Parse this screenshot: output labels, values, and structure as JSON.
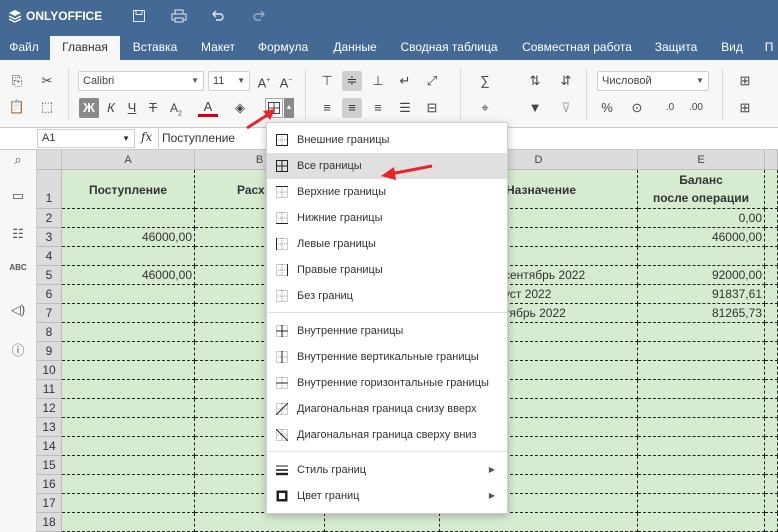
{
  "app": {
    "name": "ONLYOFFICE"
  },
  "menu": {
    "tabs": [
      "Файл",
      "Главная",
      "Вставка",
      "Макет",
      "Формула",
      "Данные",
      "Сводная таблица",
      "Совместная работа",
      "Защита",
      "Вид",
      "П"
    ],
    "active": "Главная"
  },
  "toolbar": {
    "font_name": "Calibri",
    "font_size": "11",
    "number_format": "Числовой"
  },
  "formula_bar": {
    "cell_ref": "A1",
    "fx": "fx",
    "content": "Поступление"
  },
  "columns": [
    "A",
    "B",
    "C",
    "D",
    "E"
  ],
  "rows": [
    "1",
    "2",
    "3",
    "4",
    "5",
    "6",
    "7",
    "8",
    "9",
    "10",
    "11",
    "12",
    "13",
    "14",
    "15",
    "16",
    "17",
    "18"
  ],
  "cells": {
    "A1": "Поступление",
    "B1": "Расх",
    "D1": "Назначение",
    "E1_line1": "Баланс",
    "E1_line2": "после операции",
    "E2": "0,00",
    "A3": "46000,00",
    "E3": "46000,00",
    "A5": "46000,00",
    "D5": "сентябрь 2022",
    "E5": "92000,00",
    "D6": "уст 2022",
    "E6": "91837,61",
    "D7": "тябрь 2022",
    "E7": "81265,73"
  },
  "border_menu": {
    "items": [
      {
        "label": "Внешние границы",
        "icon": "outer-borders-icon"
      },
      {
        "label": "Все границы",
        "icon": "all-borders-icon",
        "highlighted": true
      },
      {
        "label": "Верхние границы",
        "icon": "top-border-icon"
      },
      {
        "label": "Нижние границы",
        "icon": "bottom-border-icon"
      },
      {
        "label": "Левые границы",
        "icon": "left-border-icon"
      },
      {
        "label": "Правые границы",
        "icon": "right-border-icon"
      },
      {
        "label": "Без границ",
        "icon": "no-borders-icon"
      },
      {
        "label": "Внутренние границы",
        "icon": "inner-borders-icon"
      },
      {
        "label": "Внутренние вертикальные границы",
        "icon": "inner-vertical-borders-icon"
      },
      {
        "label": "Внутренние горизонтальные границы",
        "icon": "inner-horizontal-borders-icon"
      },
      {
        "label": "Диагональная граница снизу вверх",
        "icon": "diagonal-up-border-icon"
      },
      {
        "label": "Диагональная граница сверху вниз",
        "icon": "diagonal-down-border-icon"
      },
      {
        "label": "Стиль границ",
        "icon": "border-style-icon"
      },
      {
        "label": "Цвет границ",
        "icon": "border-color-icon"
      }
    ]
  },
  "colors": {
    "header": "#446995",
    "cell_fill": "#d7ebd1",
    "annotation_arrow": "#e8262a"
  }
}
